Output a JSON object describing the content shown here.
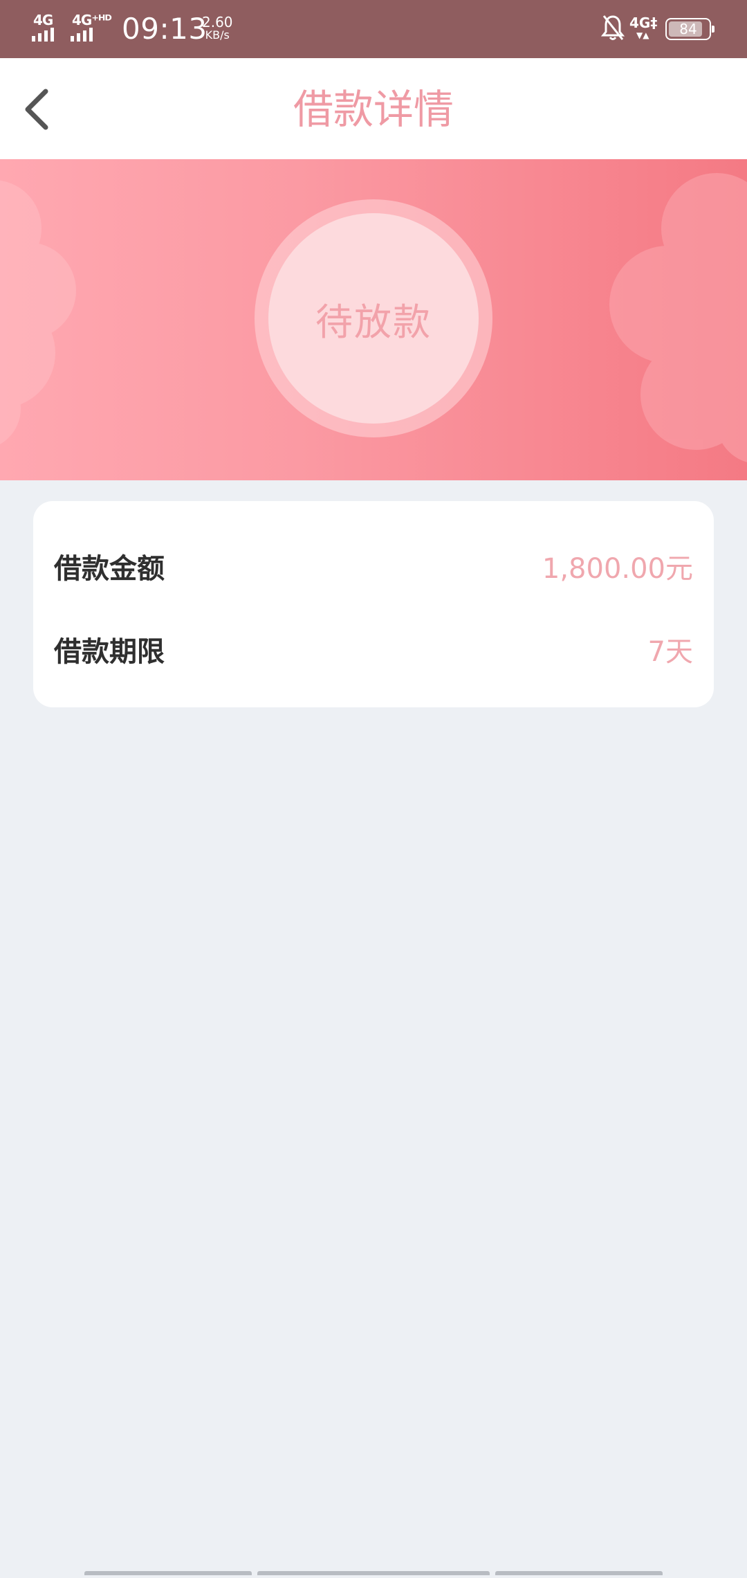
{
  "status_bar": {
    "network_1": "4G",
    "network_2": "4G⁺ᴴᴰ",
    "time": "09:13",
    "speed_value": "2.60",
    "speed_unit": "KB/s",
    "network_right": "4G‡",
    "battery": "84",
    "icons": [
      "signal-icon",
      "bell-off-icon",
      "battery-icon"
    ]
  },
  "header": {
    "title": "借款详情",
    "back_icon": "chevron-left-icon"
  },
  "banner": {
    "status": "待放款"
  },
  "details": {
    "rows": [
      {
        "label": "借款金额",
        "value": "1,800.00元"
      },
      {
        "label": "借款期限",
        "value": "7天"
      }
    ]
  },
  "colors": {
    "accent": "#ef9aa4",
    "status_bar": "#8f5d5f",
    "background": "#edf0f4",
    "banner_start": "#ffa8b1",
    "banner_end": "#f47a84",
    "value_text": "#f0a7ae"
  }
}
